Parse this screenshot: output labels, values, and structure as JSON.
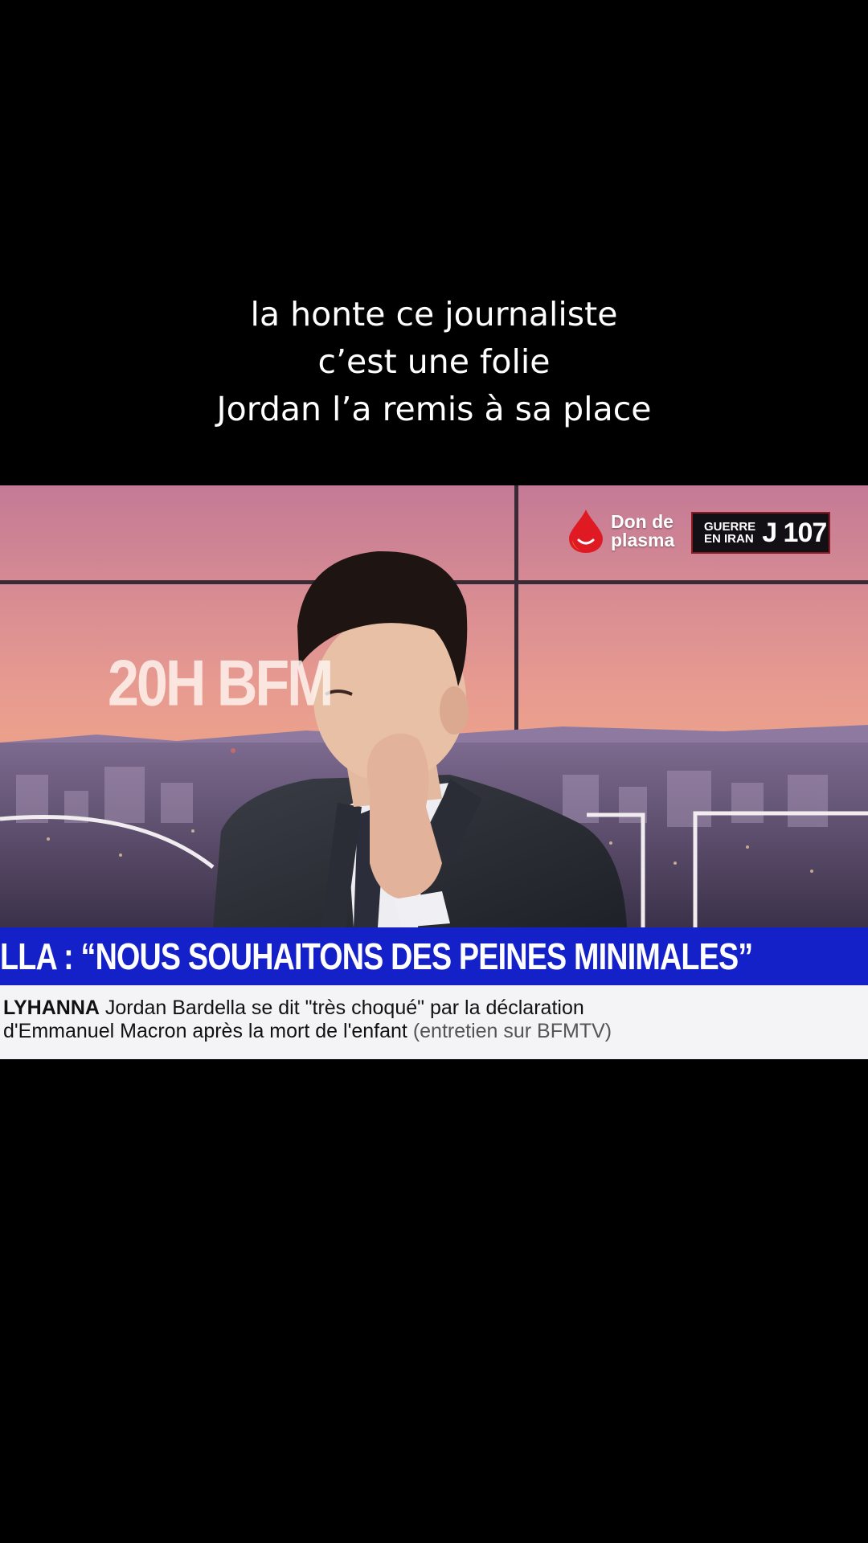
{
  "caption": {
    "line1": "la honte ce journaliste",
    "line2": "c’est une folie",
    "line3": "Jordan l’a remis à sa place"
  },
  "broadcast": {
    "logo_line1": "Don de",
    "logo_line2": "plasma",
    "day_label_line1": "GUERRE",
    "day_label_line2": "EN IRAN",
    "day_count": "J 107",
    "studio_text": "20H BFM",
    "headline": "LLA : “NOUS SOUHAITONS DES PEINES MINIMALES”",
    "sub_name": "LYHANNA",
    "sub_line1": "Jordan Bardella se dit \"très choqué\" par la déclaration",
    "sub_line2_main": "d'Emmanuel Macron après la mort de l'enfant",
    "sub_line2_gray": "(entretien sur BFMTV)"
  },
  "colors": {
    "headline_bg": "#1420c8",
    "drop_red": "#e01a22",
    "sub_bg": "#f4f4f6"
  }
}
